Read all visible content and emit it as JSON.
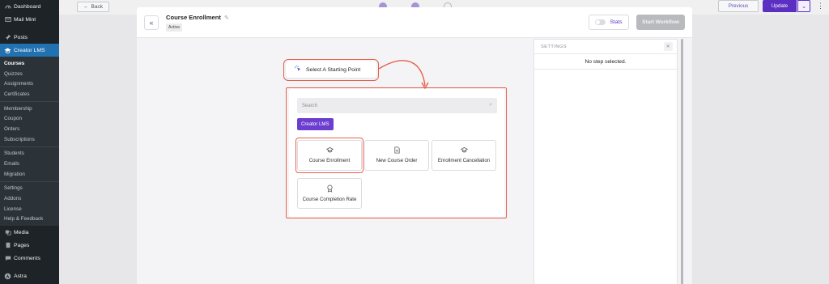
{
  "sidebar": {
    "top_items": [
      {
        "label": "Dashboard",
        "icon": "dashboard-icon"
      },
      {
        "label": "Mail Mint",
        "icon": "mail-icon"
      },
      {
        "label": "Posts",
        "icon": "pin-icon"
      },
      {
        "label": "Creator LMS",
        "icon": "graduation-cap-icon"
      }
    ],
    "sub_items_group1": [
      "Courses",
      "Quizzes",
      "Assignments",
      "Certificates"
    ],
    "sub_items_group2": [
      "Membership",
      "Coupon",
      "Orders",
      "Subscriptions"
    ],
    "sub_items_group3": [
      "Students",
      "Emails",
      "Migration"
    ],
    "sub_items_group4": [
      "Settings",
      "Addons",
      "License",
      "Help & Feedback"
    ],
    "bottom_items": [
      {
        "label": "Media",
        "icon": "media-icon"
      },
      {
        "label": "Pages",
        "icon": "pages-icon"
      },
      {
        "label": "Comments",
        "icon": "comments-icon"
      },
      {
        "label": "Astra",
        "icon": "astra-icon"
      }
    ]
  },
  "topbar": {
    "back_label": "Back",
    "previous_label": "Previous",
    "update_label": "Update"
  },
  "workflow": {
    "title": "Course Enrollment",
    "status": "Active",
    "stats_label": "Stats",
    "start_label": "Start Workflow",
    "start_point_label": "Select A Starting Point",
    "search_placeholder": "Search",
    "category_label": "Creator LMS",
    "triggers": [
      "Course Enrollment",
      "New Course Order",
      "Enrollment Cancellation",
      "Course Completion Rate"
    ]
  },
  "settings": {
    "heading": "SETTINGS",
    "empty_message": "No step selected."
  },
  "colors": {
    "accent": "#6b3ecf",
    "highlight": "#e8604c",
    "wp_sidebar": "#1d2327",
    "wp_active": "#2271b1"
  }
}
